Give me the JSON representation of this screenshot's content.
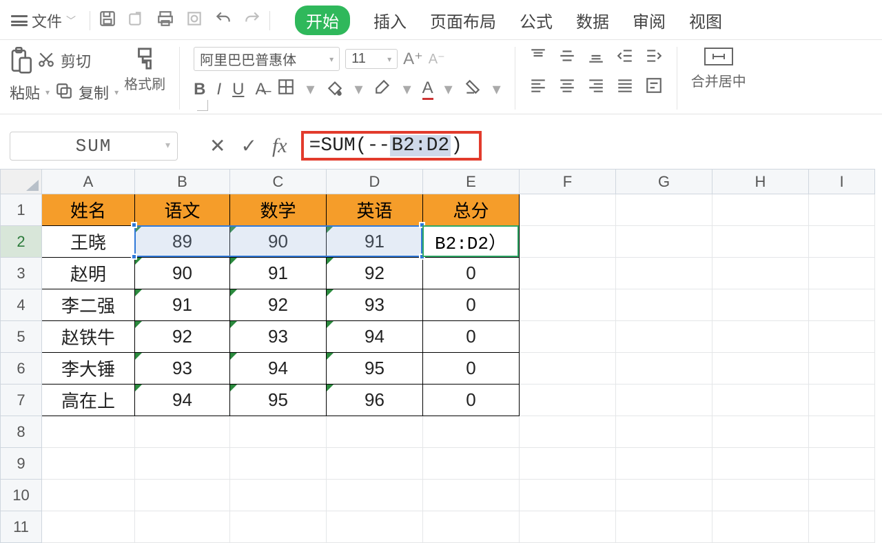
{
  "menu": {
    "file_label": "文件",
    "tabs": [
      "开始",
      "插入",
      "页面布局",
      "公式",
      "数据",
      "审阅",
      "视图"
    ],
    "active_tab": "开始"
  },
  "ribbon": {
    "paste_label": "粘贴",
    "cut_label": "剪切",
    "copy_label": "复制",
    "format_painter_label": "格式刷",
    "font_name": "阿里巴巴普惠体",
    "font_size": "11",
    "merge_center_label": "合并居中"
  },
  "formula_bar": {
    "name_box": "SUM",
    "formula_prefix": "=SUM(--",
    "formula_range": "B2:D2",
    "formula_suffix": ")"
  },
  "sheet": {
    "columns": [
      "A",
      "B",
      "C",
      "D",
      "E",
      "F",
      "G",
      "H",
      "I"
    ],
    "row_headers": [
      1,
      2,
      3,
      4,
      5,
      6,
      7,
      8,
      9,
      10,
      11
    ],
    "header_row": {
      "A": "姓名",
      "B": "语文",
      "C": "数学",
      "D": "英语",
      "E": "总分"
    },
    "data_rows": [
      {
        "A": "王晓",
        "B": "89",
        "C": "90",
        "D": "91",
        "E": ""
      },
      {
        "A": "赵明",
        "B": "90",
        "C": "91",
        "D": "92",
        "E": "0"
      },
      {
        "A": "李二强",
        "B": "91",
        "C": "92",
        "D": "93",
        "E": "0"
      },
      {
        "A": "赵铁牛",
        "B": "92",
        "C": "93",
        "D": "94",
        "E": "0"
      },
      {
        "A": "李大锤",
        "B": "93",
        "C": "94",
        "D": "95",
        "E": "0"
      },
      {
        "A": "高在上",
        "B": "94",
        "C": "95",
        "D": "96",
        "E": "0"
      }
    ],
    "active_cell_display": "B2:D2）",
    "active_row": 2
  },
  "chart_data": {
    "type": "table",
    "title": "",
    "columns": [
      "姓名",
      "语文",
      "数学",
      "英语",
      "总分"
    ],
    "rows": [
      [
        "王晓",
        89,
        90,
        91,
        null
      ],
      [
        "赵明",
        90,
        91,
        92,
        0
      ],
      [
        "李二强",
        91,
        92,
        93,
        0
      ],
      [
        "赵铁牛",
        92,
        93,
        94,
        0
      ],
      [
        "李大锤",
        93,
        94,
        95,
        0
      ],
      [
        "高在上",
        94,
        95,
        96,
        0
      ]
    ]
  }
}
